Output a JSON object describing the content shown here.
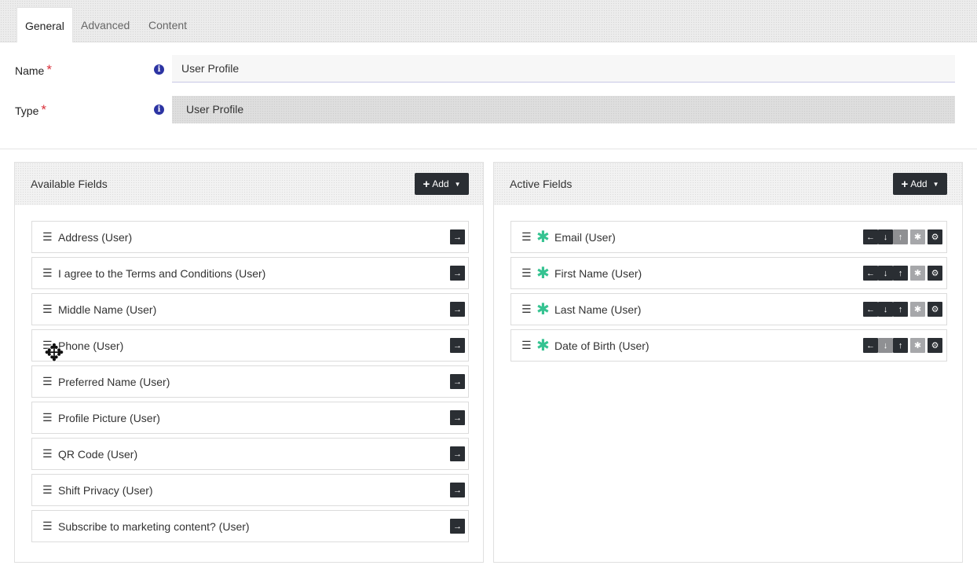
{
  "tabs": [
    {
      "label": "General"
    },
    {
      "label": "Advanced"
    },
    {
      "label": "Content"
    }
  ],
  "form": {
    "name_label": "Name",
    "name_value": "User Profile",
    "type_label": "Type",
    "type_value": "User Profile",
    "required_mark": "*",
    "info_glyph": "i"
  },
  "available": {
    "title": "Available Fields",
    "add_label": "Add",
    "items": [
      {
        "label": "Address (User)"
      },
      {
        "label": "I agree to the Terms and Conditions (User)"
      },
      {
        "label": "Middle Name (User)"
      },
      {
        "label": "Phone (User)"
      },
      {
        "label": "Preferred Name (User)"
      },
      {
        "label": "Profile Picture (User)"
      },
      {
        "label": "QR Code (User)"
      },
      {
        "label": "Shift Privacy (User)"
      },
      {
        "label": "Subscribe to marketing content? (User)"
      }
    ]
  },
  "active": {
    "title": "Active Fields",
    "add_label": "Add",
    "items": [
      {
        "label": "Email (User)"
      },
      {
        "label": "First Name (User)"
      },
      {
        "label": "Last Name (User)"
      },
      {
        "label": "Date of Birth (User)"
      }
    ]
  },
  "icons": {
    "handle": "drag-handle-icon",
    "move_right": "arrow-right-icon",
    "left": "arrow-left-icon",
    "down": "arrow-down-icon",
    "up": "arrow-up-icon",
    "required": "asterisk-icon",
    "settings": "gear-icon",
    "cursor": "move-cursor-icon"
  },
  "colors": {
    "button_dark": "#2a2e33",
    "required_red": "#d9303a",
    "required_star_green": "#35c391",
    "info_blue": "#2c34a3"
  }
}
